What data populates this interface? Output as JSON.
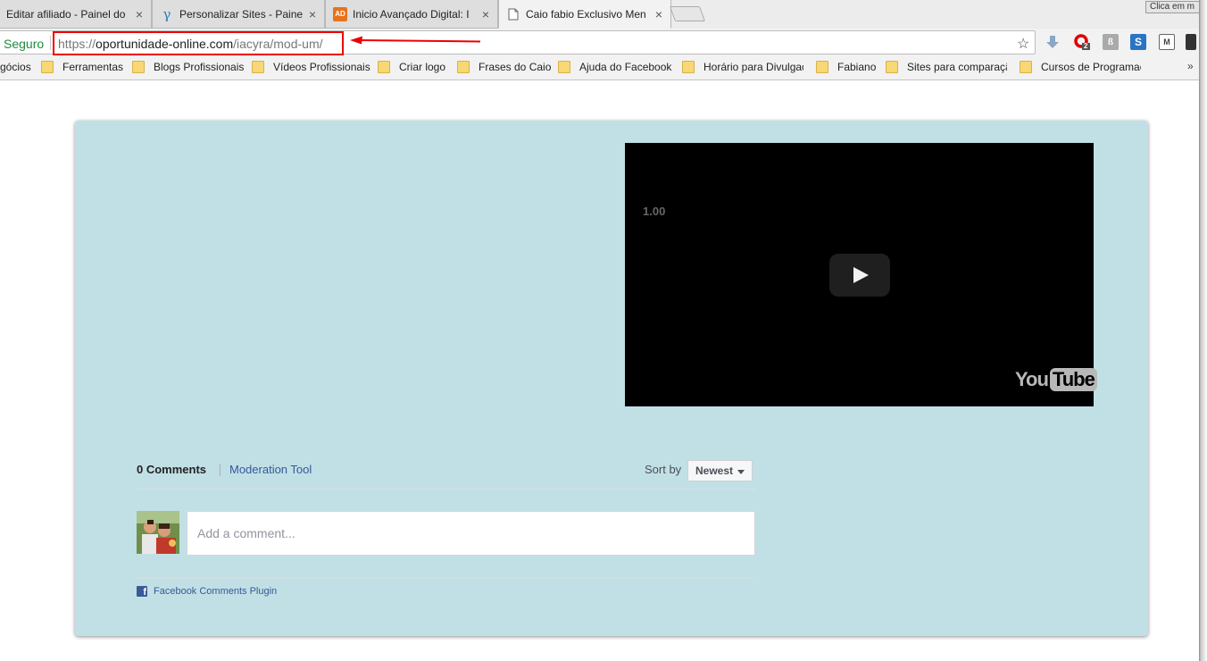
{
  "tabs": [
    {
      "title": "Editar afiliado - Painel do",
      "favicon": "page-icon"
    },
    {
      "title": "Personalizar Sites - Painel",
      "favicon": "gamma-icon"
    },
    {
      "title": "Inicio Avançado Digital: I",
      "favicon": "ad-icon"
    },
    {
      "title": "Caio fabio Exclusivo Men",
      "favicon": "blank-page-icon"
    }
  ],
  "window_tooltip": "Clica em m",
  "toolbar": {
    "security_label": "Seguro",
    "url_protocol": "https://",
    "url_domain": "oportunidade-online.com",
    "url_path": "/iacyra/mod-um/"
  },
  "extensions": [
    {
      "name": "download-arrow-icon"
    },
    {
      "name": "opera-icon",
      "badge": "2"
    },
    {
      "name": "shield-icon"
    },
    {
      "name": "s-icon"
    },
    {
      "name": "m-icon"
    },
    {
      "name": "menu-icon"
    }
  ],
  "bookmarks": [
    "gócios",
    "Ferramentas",
    "Blogs Profissionais",
    "Vídeos Profissionais",
    "Criar logo",
    "Frases do Caio",
    "Ajuda do Facebook",
    "Horário para Divulgaç",
    "Fabiano",
    "Sites para comparaçã",
    "Cursos de Programaç"
  ],
  "bookmarks_more": "»",
  "video": {
    "speed_label": "1.00",
    "logo_you": "You",
    "logo_tube": "Tube"
  },
  "comments": {
    "count_label": "0 Comments",
    "moderation_label": "Moderation Tool",
    "sort_label": "Sort by",
    "sort_value": "Newest",
    "placeholder": "Add a comment...",
    "plugin_label": "Facebook Comments Plugin"
  },
  "colors": {
    "card_bg": "#c1e0e5",
    "fb_blue": "#365899",
    "secure_green": "#1e8e3e",
    "highlight_red": "#e00000"
  }
}
